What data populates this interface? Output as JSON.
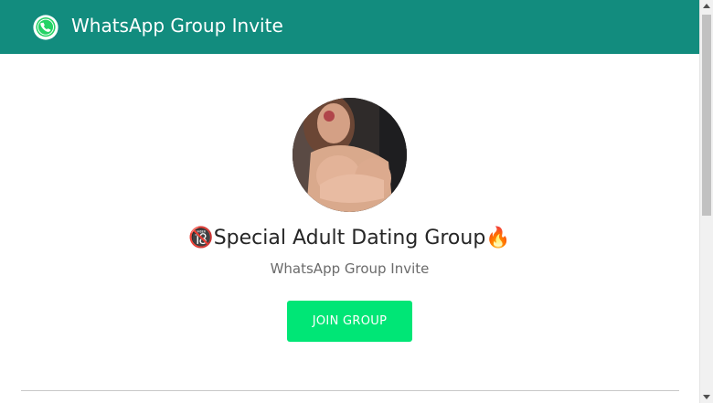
{
  "header": {
    "title": "WhatsApp Group Invite",
    "logo_icon": "whatsapp-logo-icon"
  },
  "group": {
    "avatar": "group-avatar-photo",
    "name": "🔞Special Adult Dating Group🔥",
    "subtitle": "WhatsApp Group Invite",
    "join_label": "JOIN GROUP"
  },
  "colors": {
    "header_bg": "#128c7e",
    "button_bg": "#00e676",
    "button_text": "#ffffff"
  }
}
